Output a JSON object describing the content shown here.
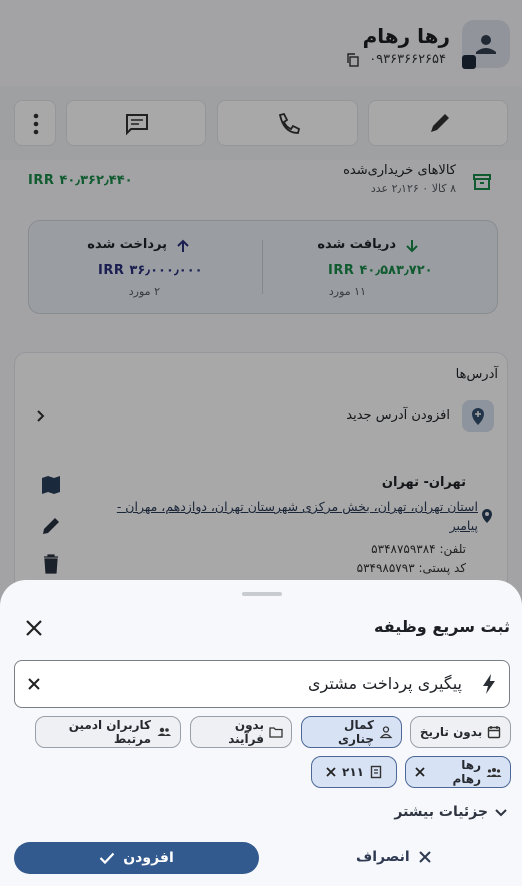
{
  "header": {
    "name": "رها رهام",
    "phone": "۰۹۳۶۳۶۶۲۶۵۴"
  },
  "purchases": {
    "title": "کالاهای خریداری‌شده",
    "subtitle": "۸ کالا ۰ ۲٫۱۲۶ عدد",
    "amount": "IRR ۴۰٫۳۶۲٫۴۴۰"
  },
  "payments": {
    "received_label": "دریافت شده",
    "received_amount": "IRR ۴۰٫۵۸۳٫۷۲۰",
    "received_count": "۱۱ مورد",
    "paid_label": "پرداخت شده",
    "paid_amount": "IRR ۳۶٫۰۰۰٫۰۰۰",
    "paid_count": "۲ مورد"
  },
  "addresses": {
    "title": "آدرس‌ها",
    "add_new": "افزودن آدرس جدید",
    "city": "تهران- تهران",
    "line1": "استان تهران، تهران، بخش مرکزی شهرستان تهران، دوازدهم، مهران -",
    "line2": "پیامبر",
    "phone": "تلفن: ۵۳۴۸۷۵۹۳۸۴",
    "postal": "کد پستی: ۵۳۴۹۸۵۷۹۳"
  },
  "sheet": {
    "title": "ثبت سریع وظیفه",
    "task_value": "پیگیری پرداخت مشتری",
    "chips": {
      "no_date": "بدون تاریخ",
      "assignee": "کمال چناری",
      "no_process": "بدون فرآیند",
      "admin_users": "کاربران ادمین مرتبط",
      "customer": "رها رهام",
      "code": "۲۱۱"
    },
    "more_details": "جزئیات بیشتر",
    "add_button": "افزودن",
    "cancel_button": "انصراف"
  },
  "colors": {
    "accent": "#335a8e",
    "green": "#1b8a4a",
    "selected_chip": "#d7e2f4",
    "sheet_bg": "#f6f8fc"
  }
}
